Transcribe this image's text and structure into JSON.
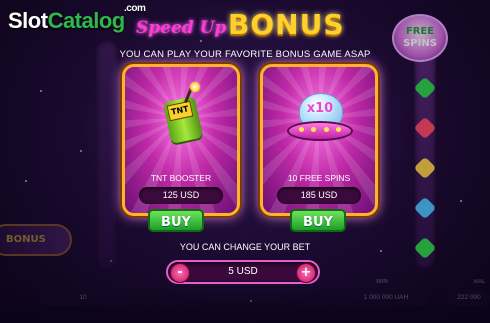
{
  "brand": {
    "logo_slot": "Slot",
    "logo_catalog": "Catalog",
    "logo_com": ".com"
  },
  "header": {
    "title_script": "Speed Up",
    "title_main": "BONUS",
    "subtitle": "YOU CAN PLAY YOUR FAVORITE BONUS GAME ASAP"
  },
  "side_badge": {
    "line1": "FREE",
    "line2": "SPINS"
  },
  "offers": [
    {
      "name": "TNT BOOSTER",
      "icon": "tnt-dynamite-icon",
      "icon_text": "TNT",
      "price": "125 USD",
      "buy_label": "BUY"
    },
    {
      "name": "10 FREE SPINS",
      "icon": "ufo-x10-icon",
      "icon_text": "x10",
      "price": "185 USD",
      "buy_label": "BUY"
    }
  ],
  "bet": {
    "prompt": "YOU CAN CHANGE YOUR BET",
    "value": "5 USD",
    "minus_label": "-",
    "plus_label": "+"
  },
  "background_ui": {
    "bonus_button": "BONUS",
    "bet_amount": "10",
    "win_label": "WIN",
    "win_amount": "1 000 000 UAH",
    "balance_label": "BAL",
    "balance_amount": "222 000"
  },
  "colors": {
    "card_border": "#ffb32a",
    "card_fill": "#c02aa8",
    "buy_green": "#1d9e2a",
    "title_gold": "#ffd02a",
    "title_pink": "#ff3bd4"
  }
}
